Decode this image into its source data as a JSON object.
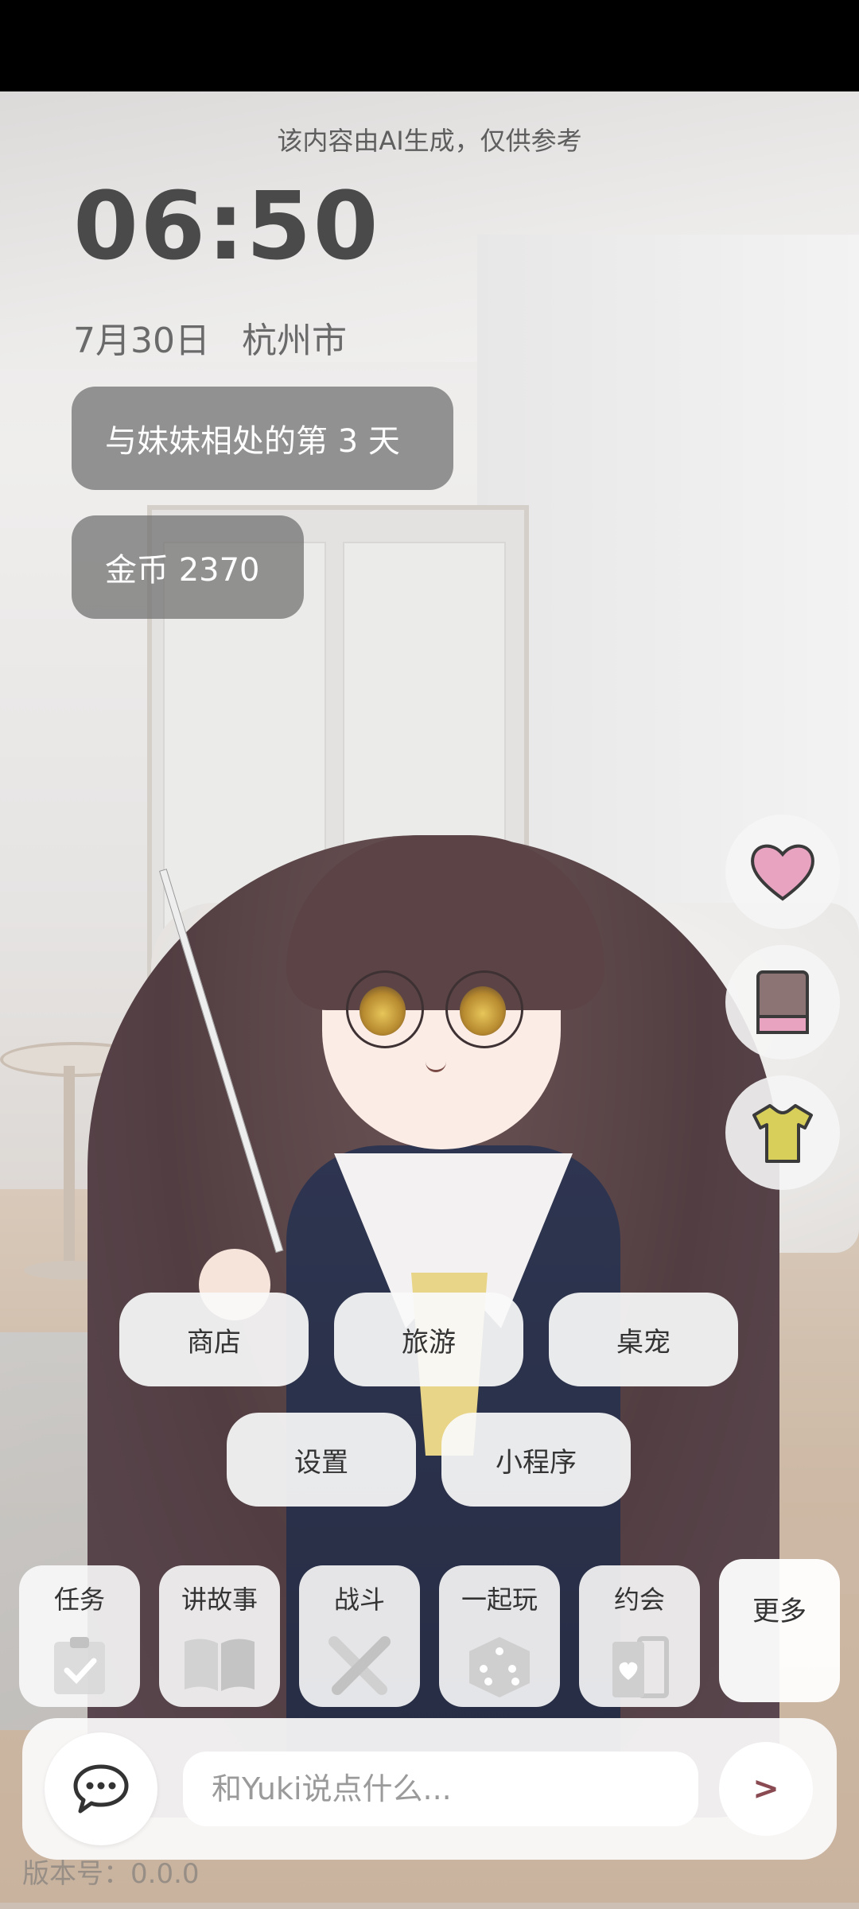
{
  "ai_note": "该内容由AI生成，仅供参考",
  "clock": "06:50",
  "date": "7月30日",
  "location": "杭州市",
  "days_badge": "与妹妹相处的第 3 天",
  "coins_badge": "金币 2370",
  "side_buttons": {
    "favorite_icon": "heart-icon",
    "diary_icon": "book-icon",
    "outfit_icon": "shirt-icon"
  },
  "menu": {
    "shop": "商店",
    "travel": "旅游",
    "desktop_pet": "桌宠",
    "settings": "设置",
    "mini_program": "小程序"
  },
  "tiles": [
    {
      "label": "任务",
      "icon": "clipboard-check-icon"
    },
    {
      "label": "讲故事",
      "icon": "book-open-icon"
    },
    {
      "label": "战斗",
      "icon": "crossed-swords-icon"
    },
    {
      "label": "一起玩",
      "icon": "dice-icon"
    },
    {
      "label": "约会",
      "icon": "cards-icon"
    }
  ],
  "more": "更多",
  "chat": {
    "placeholder": "和Yuki说点什么...",
    "send": ">",
    "chat_icon": "speech-bubble-icon"
  },
  "version": "版本号：0.0.0",
  "colors": {
    "accent": "#8a4a52",
    "heart": "#e8a3c1",
    "shirt": "#d7cf5a"
  }
}
